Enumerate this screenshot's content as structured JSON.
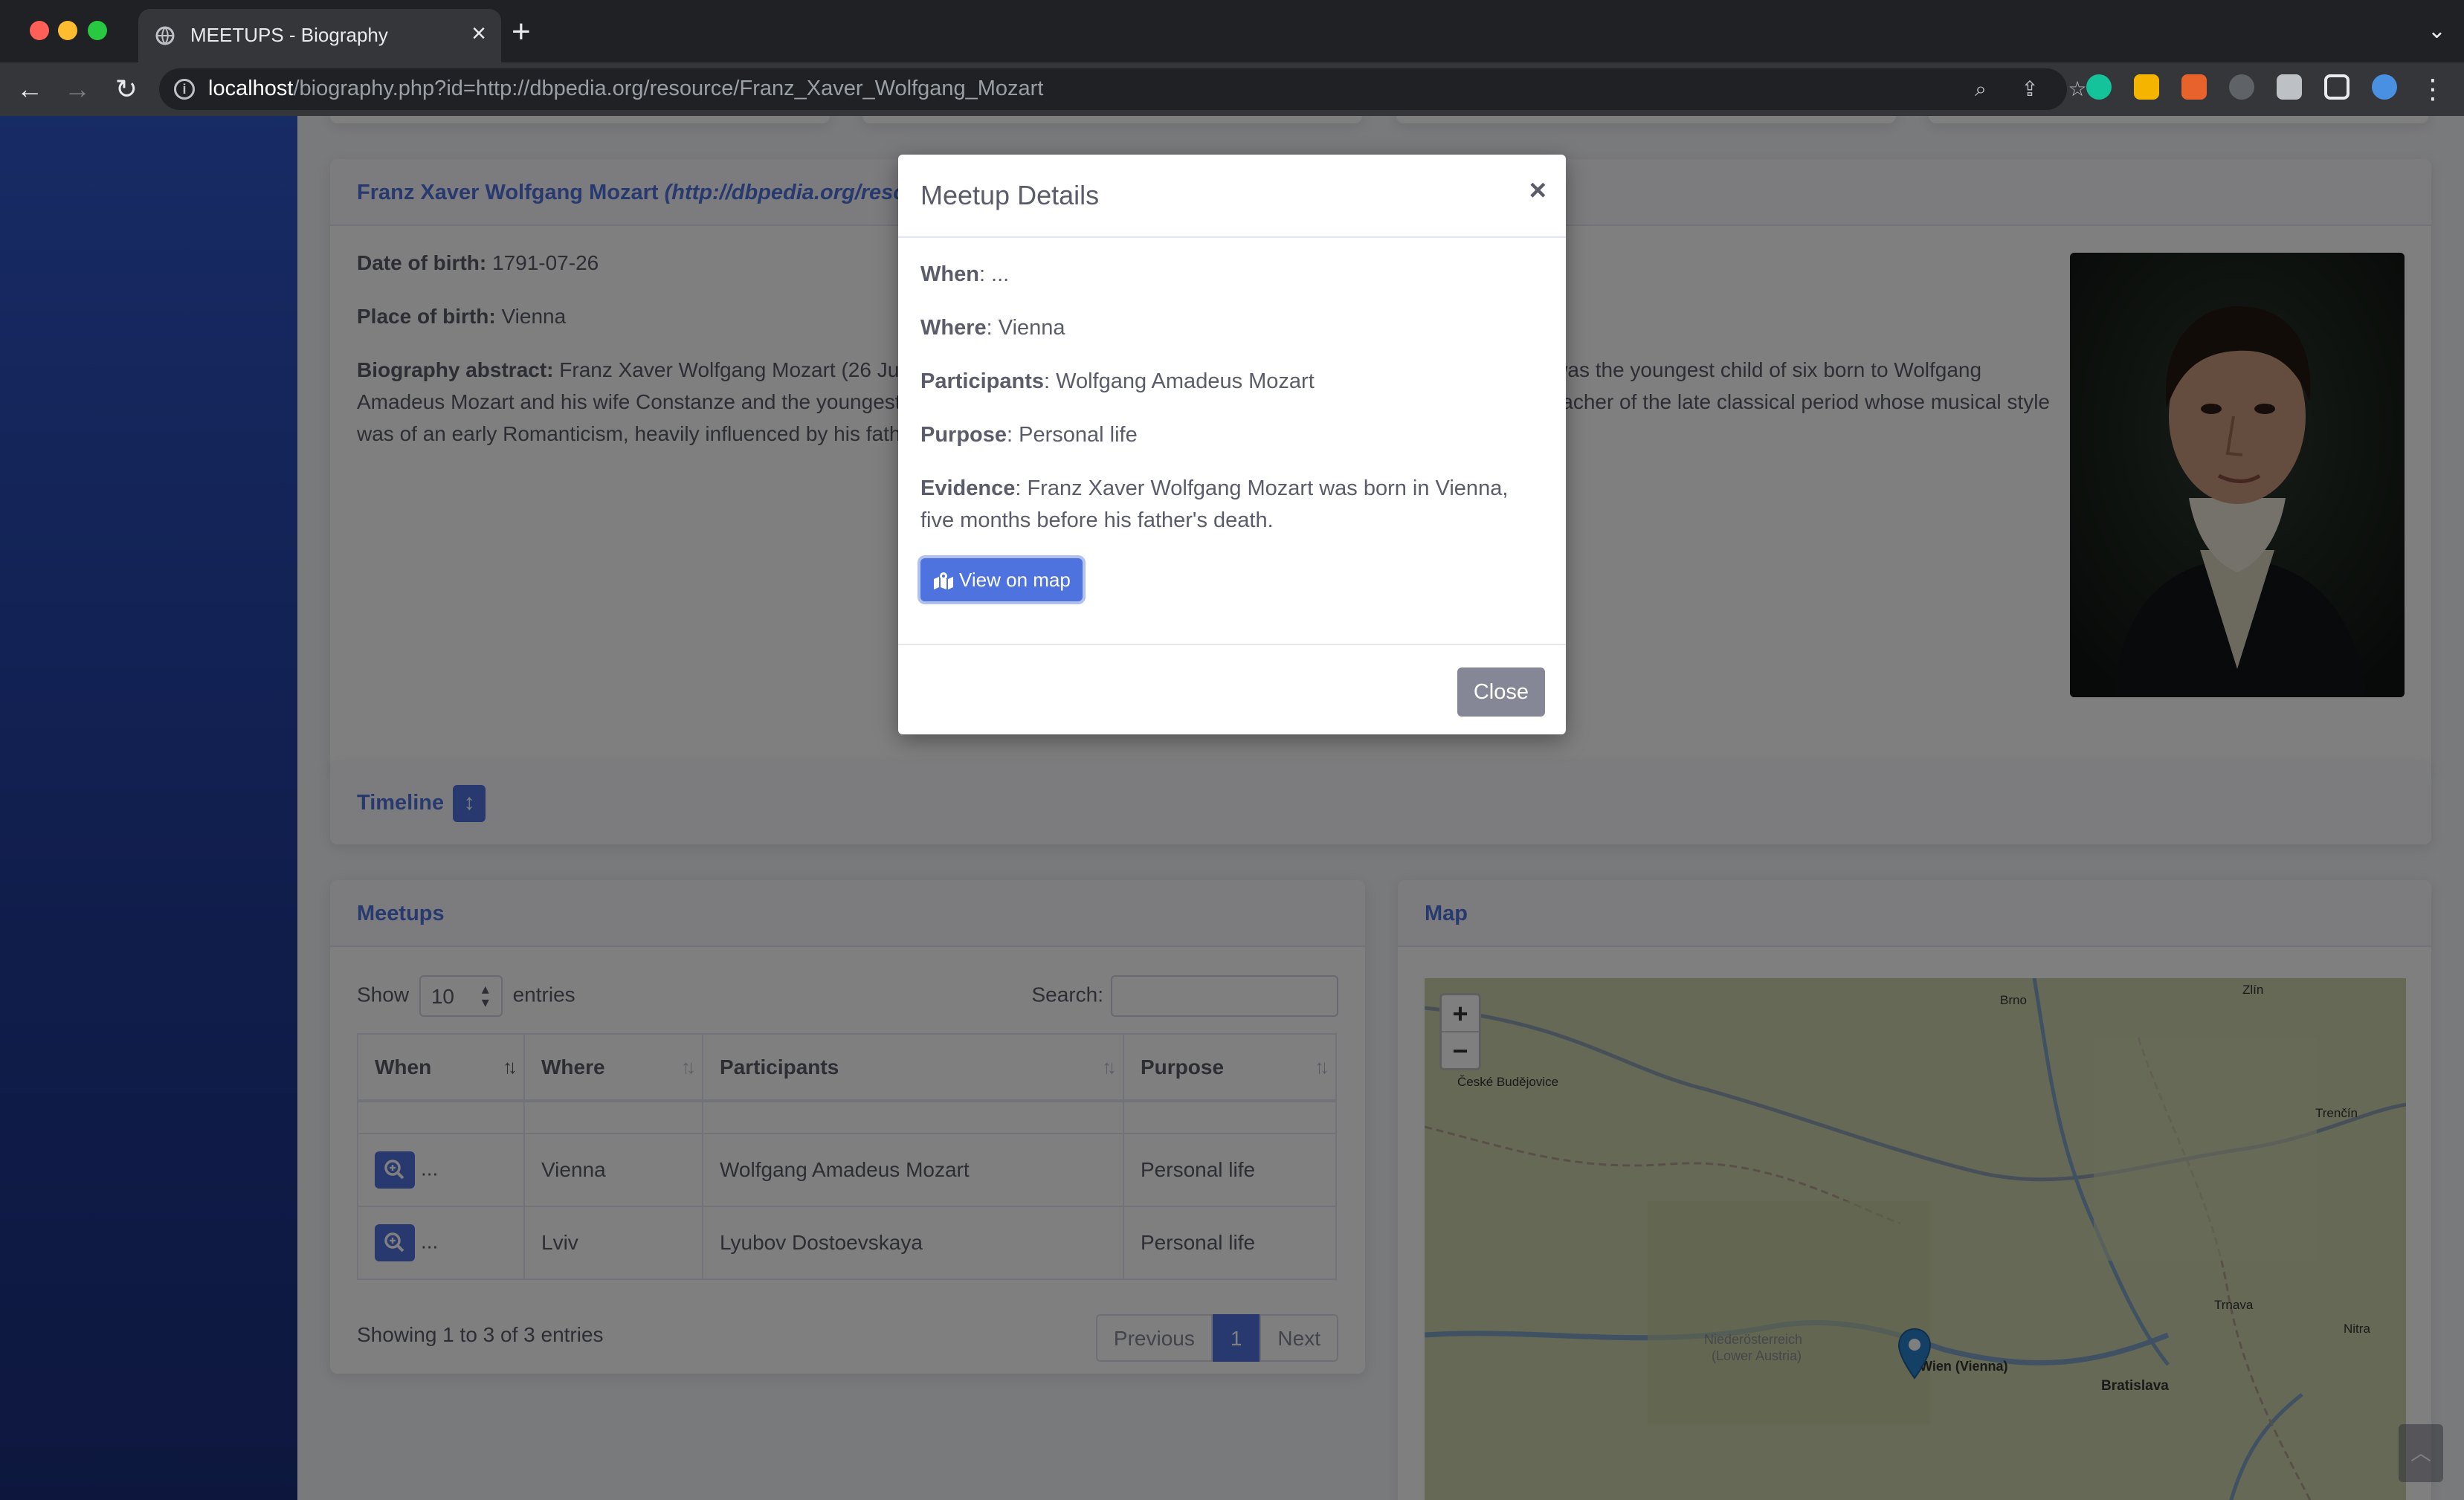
{
  "browser": {
    "tab_title": "MEETUPS - Biography",
    "url_host": "localhost",
    "url_rest": "/biography.php?id=http://dbpedia.org/resource/Franz_Xaver_Wolfgang_Mozart"
  },
  "bio": {
    "header_name": "Franz Xaver Wolfgang Mozart",
    "header_uri": "(http://dbpedia.org/resource/Franz_Xaver_Wolfgang_Mozart)",
    "dob_label": "Date of birth:",
    "dob_value": "1791-07-26",
    "pob_label": "Place of birth:",
    "pob_value": "Vienna",
    "abstract_label": "Biography abstract:",
    "abstract_text": "Franz Xaver Wolfgang Mozart (26 July 1791 – 29 July 1844), also known as Wolfgang Amadeus Mozart Jr., was the youngest child of six born to Wolfgang Amadeus Mozart and his wife Constanze and the youngest of the two who survived. He was a composer, pianist, conductor, and teacher of the late classical period whose musical style was of an early Romanticism, heavily influenced by his father's mature style."
  },
  "timeline": {
    "label": "Timeline"
  },
  "meetups": {
    "title": "Meetups",
    "show_label": "Show",
    "page_size": "10",
    "entries_label": "entries",
    "search_label": "Search:",
    "columns": [
      "When",
      "Where",
      "Participants",
      "Purpose"
    ],
    "rows": [
      {
        "when": "...",
        "where": "Vienna",
        "participants": "Wolfgang Amadeus Mozart",
        "purpose": "Personal life"
      },
      {
        "when": "...",
        "where": "Lviv",
        "participants": "Lyubov Dostoevskaya",
        "purpose": "Personal life"
      }
    ],
    "info": "Showing 1 to 3 of 3 entries",
    "prev": "Previous",
    "page": "1",
    "next": "Next"
  },
  "map": {
    "title": "Map",
    "zoom_in": "+",
    "zoom_out": "−",
    "labels": [
      "Brno",
      "Zlín",
      "České Budějovice",
      "Trenčín",
      "Trnava",
      "Nitra",
      "Niederösterreich",
      "(Lower Austria)",
      "Wien (Vienna)",
      "Bratislava"
    ]
  },
  "modal": {
    "title": "Meetup Details",
    "close_x": "×",
    "when_label": "When",
    "when_value": ": ...",
    "where_label": "Where",
    "where_value": ": Vienna",
    "participants_label": "Participants",
    "participants_value": ": Wolfgang Amadeus Mozart",
    "purpose_label": "Purpose",
    "purpose_value": ": Personal life",
    "evidence_label": "Evidence",
    "evidence_value": ": Franz Xaver Wolfgang Mozart was born in Vienna, five months before his father's death.",
    "view_map": "View on map",
    "close": "Close"
  },
  "colors": {
    "primary": "#4e73df",
    "sidebar": "#224abe",
    "secondary": "#858796"
  }
}
